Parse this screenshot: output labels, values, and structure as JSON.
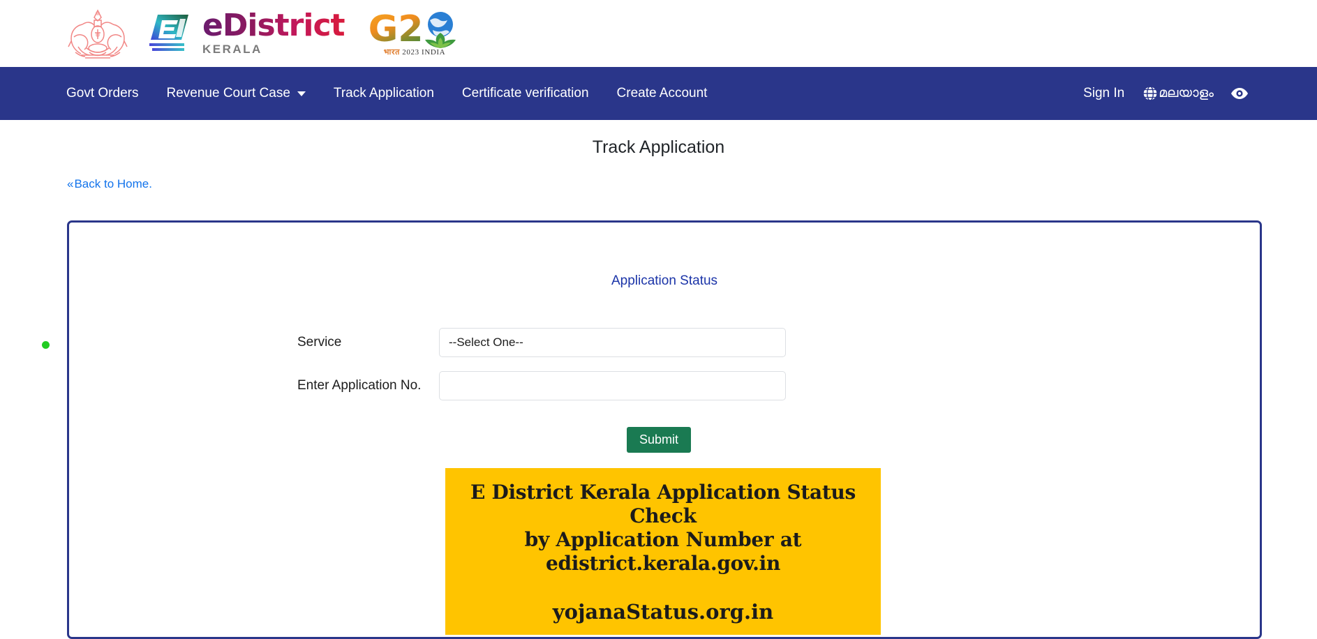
{
  "header": {
    "emblem_icon": "kerala-state-emblem-icon",
    "edistrict_mark_icon": "edistrict-monogram-icon",
    "brand_name": "eDistrict",
    "brand_sub": "KERALA",
    "g20_text": "G2",
    "g20_emblem_icon": "g20-globe-lotus-icon",
    "g20_caption_devanagari": "भारत",
    "g20_caption_rest": " 2023 INDIA"
  },
  "navbar": {
    "background_color": "#2a368a",
    "items": [
      {
        "label": "Govt Orders",
        "has_caret": false
      },
      {
        "label": "Revenue Court Case",
        "has_caret": true
      },
      {
        "label": "Track Application",
        "has_caret": false
      },
      {
        "label": "Certificate verification",
        "has_caret": false
      },
      {
        "label": "Create Account",
        "has_caret": false
      }
    ],
    "sign_in_label": "Sign In",
    "language_label": "മലയാളം",
    "globe_icon": "globe-icon",
    "eye_icon": "eye-accessibility-icon"
  },
  "page": {
    "title": "Track Application",
    "back_link_chevron": "«",
    "back_link_label": "Back to Home."
  },
  "panel": {
    "border_color": "#2a368a",
    "title": "Application Status",
    "fields": [
      {
        "label": "Service",
        "value": "--Select One--",
        "type": "select"
      },
      {
        "label": "Enter Application No.",
        "value": "",
        "placeholder": "",
        "type": "text"
      }
    ],
    "submit_label": "Submit"
  },
  "banner": {
    "background_color": "#ffc400",
    "line1": "E District Kerala Application Status Check",
    "line2": "by Application Number at",
    "line3": "edistrict.kerala.gov.in",
    "site": "yojanaStatus.org.in"
  },
  "misc": {
    "green_dot_color": "#22cc22"
  }
}
